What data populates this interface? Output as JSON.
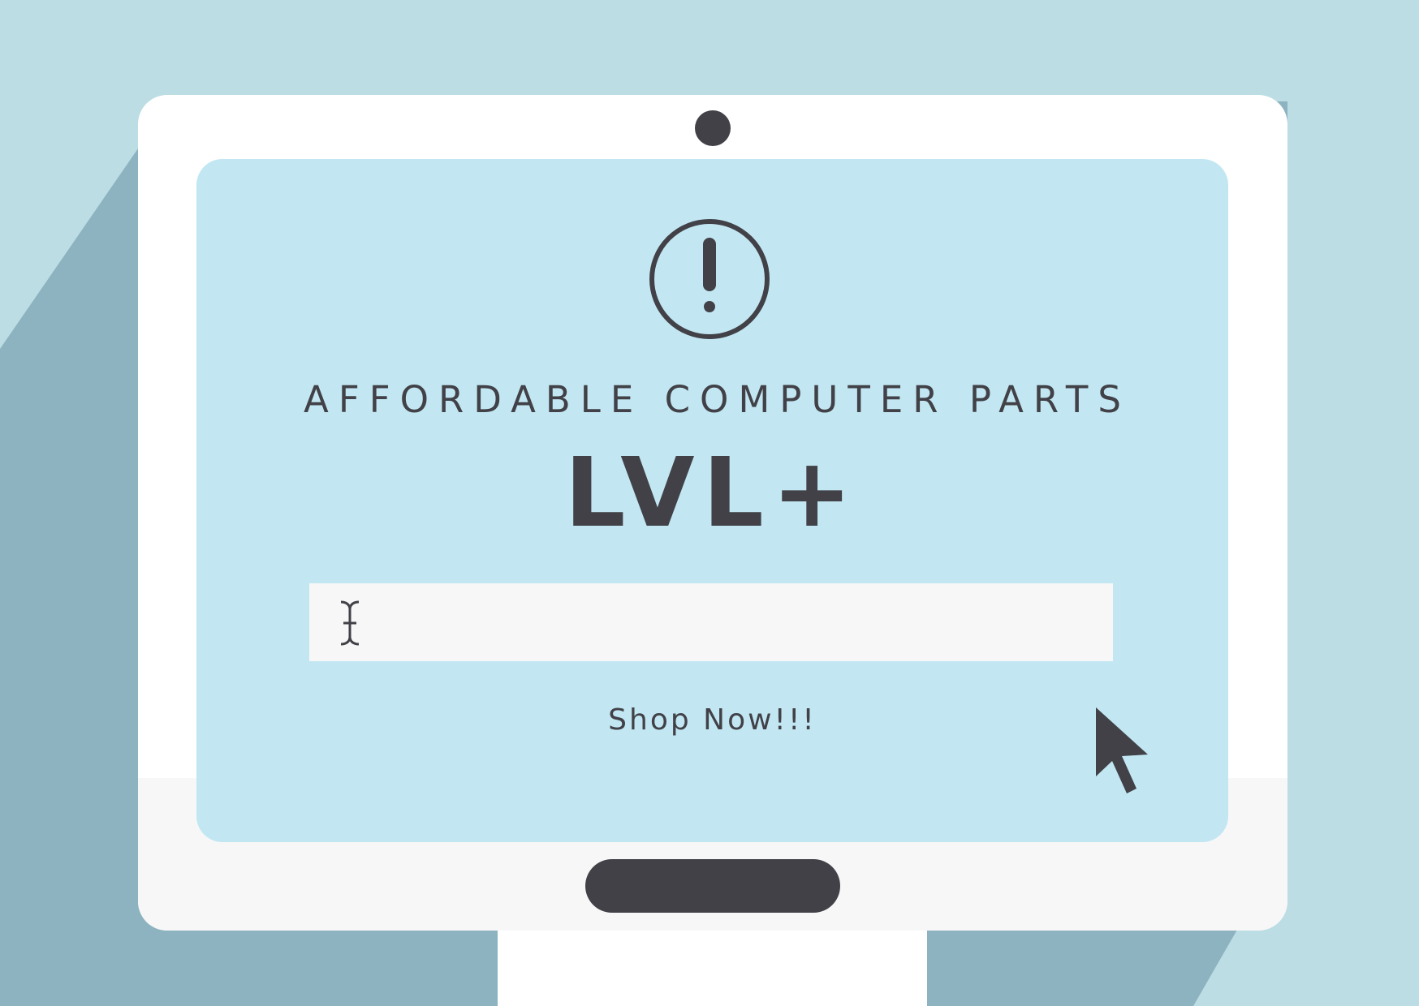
{
  "colors": {
    "background_light": "#bcdde4",
    "background_shadow": "#8db3c1",
    "monitor_frame": "#ffffff",
    "monitor_chin": "#f7f7f7",
    "screen": "#c2e7f3",
    "ink": "#414147",
    "search_field": "#f7f7f7"
  },
  "icons": {
    "alert": "exclamation-circle-icon",
    "text_cursor": "i-beam-cursor-icon",
    "pointer": "arrow-pointer-icon",
    "camera": "webcam-dot",
    "home": "home-pill-button"
  },
  "screen": {
    "tagline": "AFFORDABLE COMPUTER PARTS",
    "brand": "LVL+",
    "search": {
      "value": "",
      "placeholder": ""
    },
    "cta_label": "Shop Now!!!"
  }
}
